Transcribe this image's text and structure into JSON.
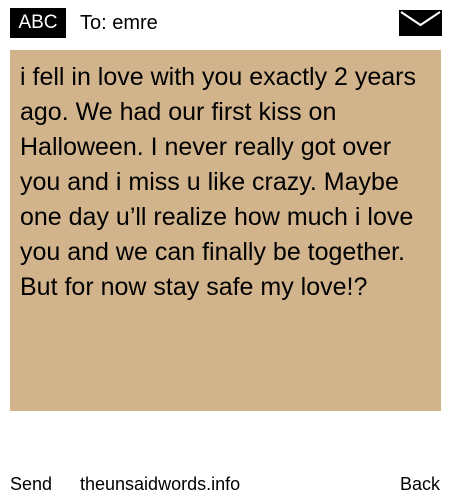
{
  "header": {
    "badge_label": "ABC",
    "recipient_label": "To: emre",
    "mail_icon": "envelope-icon"
  },
  "message": {
    "text": "i fell in love with you exactly 2 years ago. We had our first kiss on Halloween. I never really got over you and i miss u like crazy. Maybe one day u’ll realize how much i love you and we can finally be together. But for now stay safe my love!?",
    "background_color": "#d2b48c"
  },
  "footer": {
    "send_label": "Send",
    "site_label": "theunsaidwords.info",
    "back_label": "Back"
  }
}
